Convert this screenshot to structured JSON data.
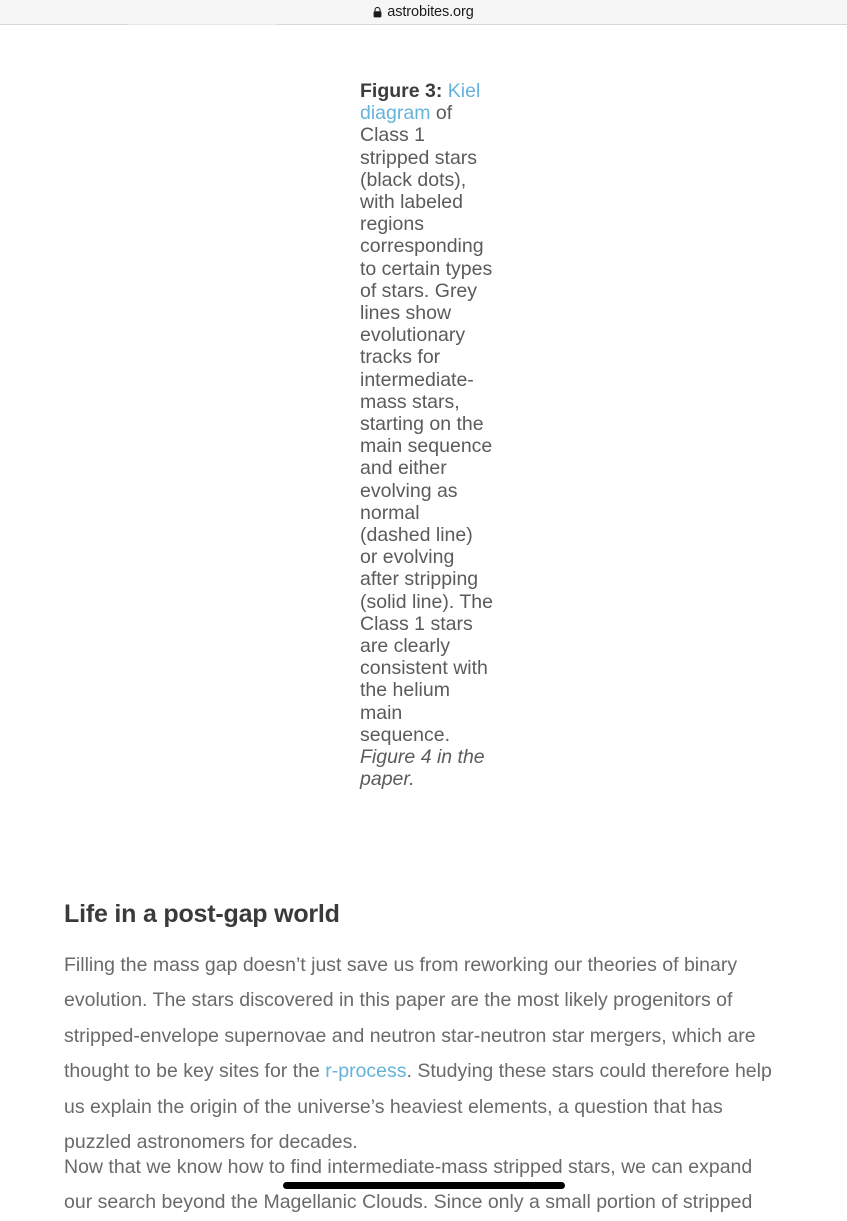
{
  "browser": {
    "lock_icon": "lock-icon",
    "url": "astrobites.org"
  },
  "figure_caption": {
    "label": "Figure 3:",
    "link_text": "Kiel diagram",
    "body_before_link": " ",
    "body_after_link": " of Class 1 stripped stars (black dots), with labeled regions corresponding to certain types of stars. Grey lines show evolutionary tracks for intermediate-mass stars, starting on the main sequence and either evolving as normal (dashed line) or evolving after stripping (solid line). The Class 1 stars are clearly consistent with the helium main sequence. ",
    "source_note": "Figure 4 in the paper."
  },
  "article": {
    "heading": "Life in a post-gap world",
    "paragraph_1_part_1": "Filling the mass gap doesn’t just save us from reworking our theories of binary evolution. The stars discovered in this paper are the most likely progenitors of stripped-envelope supernovae and neutron star-neutron star mergers, which are thought to be key sites for the ",
    "paragraph_1_link": "r-process",
    "paragraph_1_part_2": ". Studying these stars could therefore help us explain the origin of the universe’s heaviest elements, a question that has puzzled astronomers for decades.",
    "paragraph_2": "Now that we know how to find intermediate-mass stripped stars, we can expand our search beyond the Magellanic Clouds. Since only a small portion of stripped"
  },
  "colors": {
    "link": "#64b3db",
    "body_text": "#6a6a6a",
    "heading_text": "#3a3a3a",
    "chrome_background": "#f6f6f6"
  },
  "system": {
    "home_indicator": "home-indicator"
  }
}
